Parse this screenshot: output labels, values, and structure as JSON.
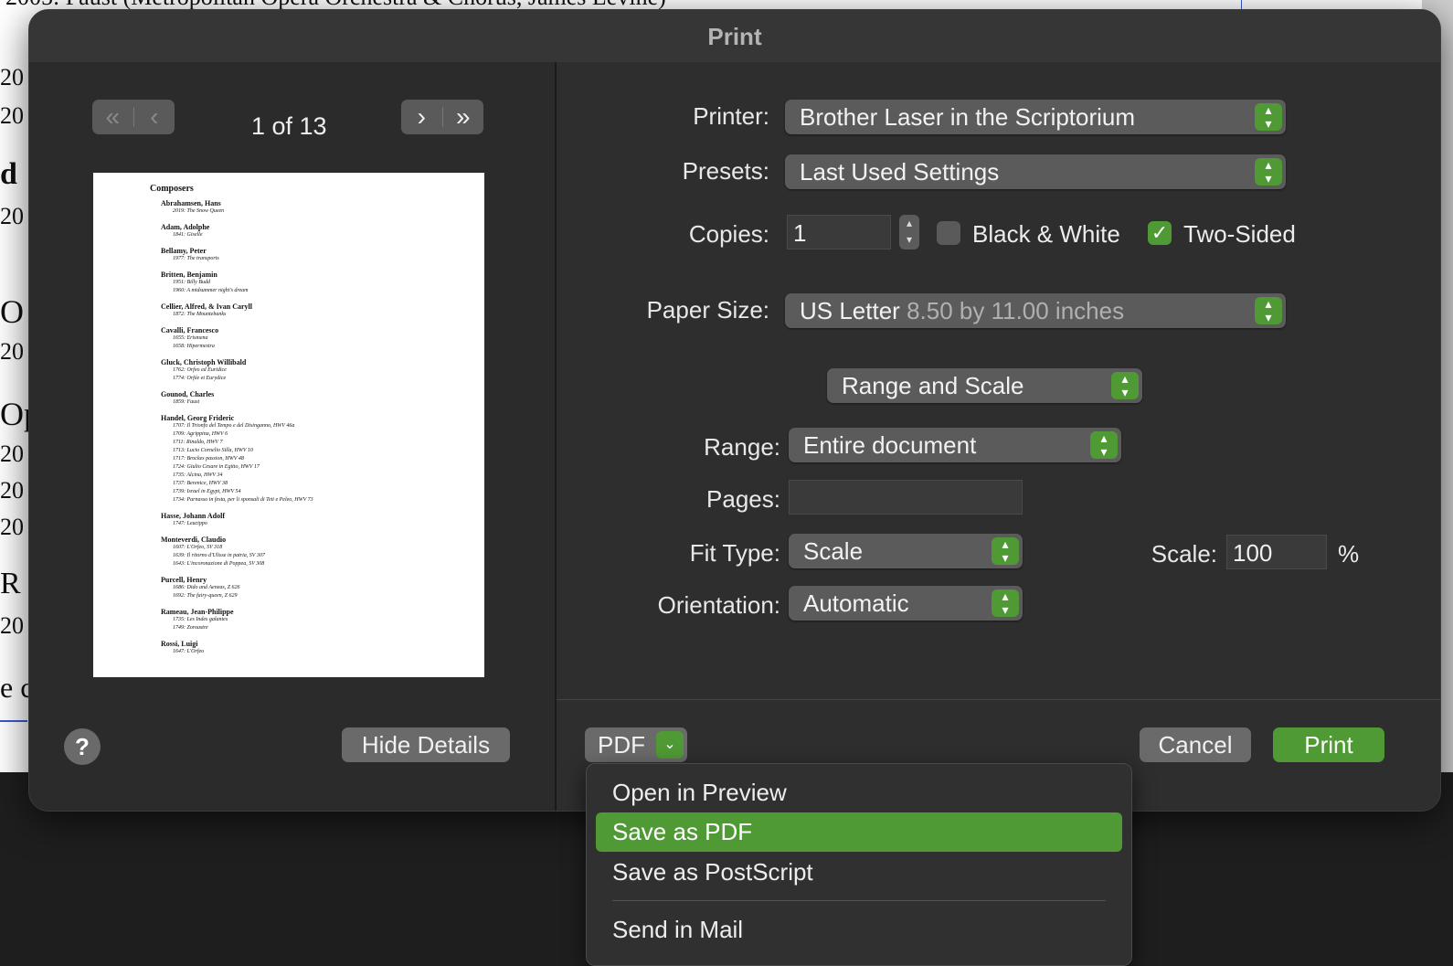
{
  "background_doc": {
    "top_line": "2005: Faust (Metropolitan Opera Orchestra & Chorus, James Levine)",
    "fragments": [
      "20",
      "20",
      "d",
      "20",
      "O",
      "20",
      "Op",
      "20",
      "20",
      "20",
      "R",
      "20",
      "e c"
    ]
  },
  "dialog": {
    "title": "Print",
    "page_counter": "1 of 13",
    "nav": {
      "first": "«",
      "prev": "‹",
      "next": "›",
      "last": "»"
    },
    "preview": {
      "heading": "Composers",
      "entries": [
        {
          "name": "Abrahamsen, Hans",
          "works": [
            "2019: The Snow Queen"
          ]
        },
        {
          "name": "Adam, Adolphe",
          "works": [
            "1841: Giselle"
          ]
        },
        {
          "name": "Bellamy, Peter",
          "works": [
            "1977: The transports"
          ]
        },
        {
          "name": "Britten, Benjamin",
          "works": [
            "1951: Billy Budd",
            "1960: A midsummer night's dream"
          ]
        },
        {
          "name": "Cellier, Alfred, & Ivan Caryll",
          "works": [
            "1872: The Mountebanks"
          ]
        },
        {
          "name": "Cavalli, Francesco",
          "works": [
            "1655: Erismena",
            "1658: Hipermestra"
          ]
        },
        {
          "name": "Gluck, Christoph Willibald",
          "works": [
            "1762: Orfeo ed Euridice",
            "1774: Orfée et Eurydice"
          ]
        },
        {
          "name": "Gounod, Charles",
          "works": [
            "1859: Faust"
          ]
        },
        {
          "name": "Handel, Georg Frideric",
          "works": [
            "1707: Il Trionfo del Tempo e del Disinganno, HWV 46a",
            "1709: Agrippina, HWV 6",
            "1711: Rinaldo, HWV 7",
            "1713: Lucio Cornelio Silla, HWV 10",
            "1717: Brockes passion, HWV 48",
            "1724: Giulio Cesare in Egitto, HWV 17",
            "1735: Alcina, HWV 34",
            "1737: Berenice, HWV 38",
            "1739: Israel in Egypt, HWV 54",
            "1734: Parnasso in festa, per li sponsali di Teti e Peleo, HWV 73"
          ]
        },
        {
          "name": "Hasse, Johann Adolf",
          "works": [
            "1747: Leucippo"
          ]
        },
        {
          "name": "Monteverdi, Claudio",
          "works": [
            "1607: L'Orfeo, SV 318",
            "1639: Il ritorno d'Ulisse in patria, SV 307",
            "1643: L'incoronazione di Poppea, SV 308"
          ]
        },
        {
          "name": "Purcell, Henry",
          "works": [
            "1686: Dido and Aeneas, Z 626",
            "1692: The fairy-queen, Z 629"
          ]
        },
        {
          "name": "Rameau, Jean-Philippe",
          "works": [
            "1735: Les Indes galantes",
            "1749: Zoroastre"
          ]
        },
        {
          "name": "Rossi, Luigi",
          "works": [
            "1647: L'Orfeo"
          ]
        }
      ]
    },
    "help_label": "?",
    "hide_details_label": "Hide Details",
    "fields": {
      "printer_label": "Printer:",
      "printer_value": "Brother Laser in the Scriptorium",
      "presets_label": "Presets:",
      "presets_value": "Last Used Settings",
      "copies_label": "Copies:",
      "copies_value": "1",
      "bw_label": "Black & White",
      "bw_checked": false,
      "two_sided_label": "Two-Sided",
      "two_sided_checked": true,
      "paper_label": "Paper Size:",
      "paper_value": "US Letter",
      "paper_dims": "8.50 by 11.00 inches",
      "section_value": "Range and Scale",
      "range_label": "Range:",
      "range_value": "Entire document",
      "pages_label": "Pages:",
      "pages_value": "",
      "fit_label": "Fit Type:",
      "fit_value": "Scale",
      "scale_label": "Scale:",
      "scale_value": "100",
      "scale_unit": "%",
      "orientation_label": "Orientation:",
      "orientation_value": "Automatic"
    },
    "pdf_label": "PDF",
    "cancel_label": "Cancel",
    "print_label": "Print",
    "pdf_menu": {
      "items": [
        "Open in Preview",
        "Save as PDF",
        "Save as PostScript",
        "Send in Mail"
      ],
      "selected": "Save as PDF"
    }
  },
  "colors": {
    "accent": "#4f9a34",
    "dialog_bg": "#2b2b2b",
    "control_bg": "#5b5b5b"
  },
  "icons": [
    "first-page-icon",
    "prev-page-icon",
    "next-page-icon",
    "last-page-icon",
    "popup-arrows-icon",
    "checkmark-icon",
    "chevron-down-icon",
    "help-icon"
  ]
}
